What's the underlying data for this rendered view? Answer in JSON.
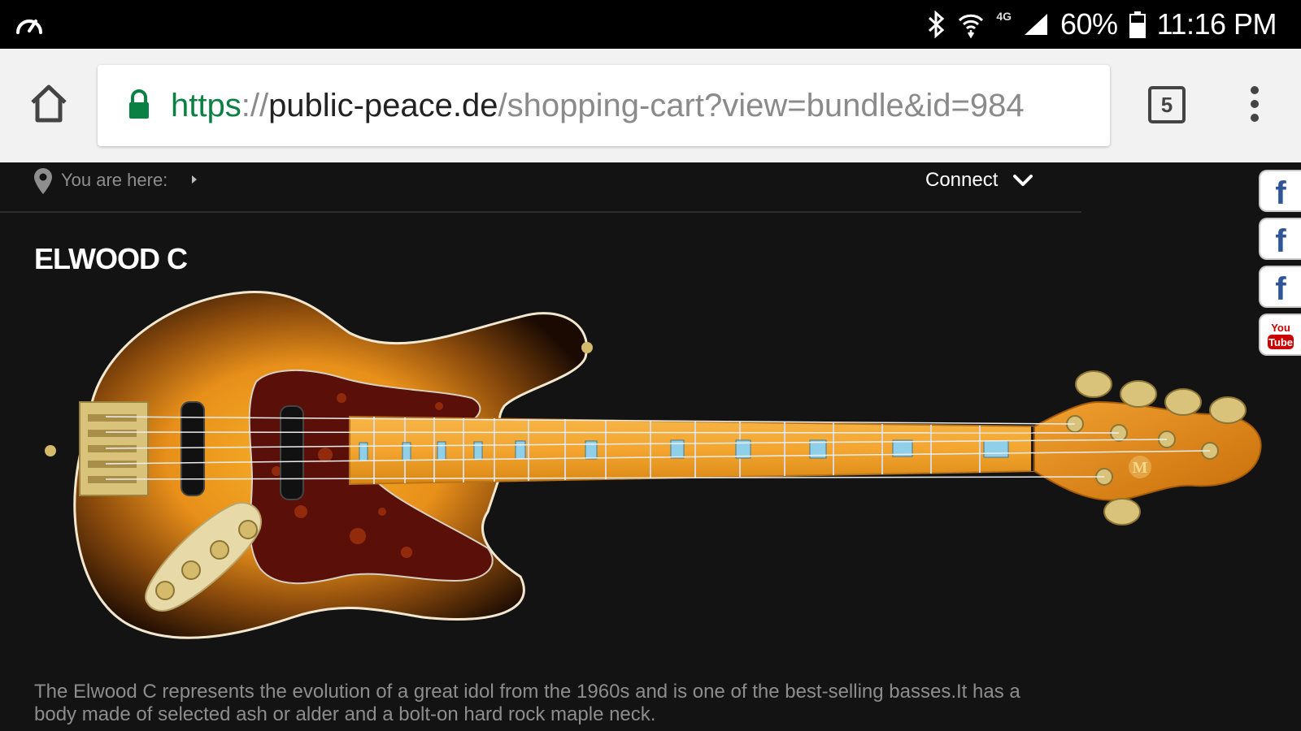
{
  "status_bar": {
    "battery": "60%",
    "time": "11:16 PM",
    "network": "4G",
    "icons": [
      "speedometer-icon",
      "bluetooth-icon",
      "wifi-icon",
      "signal-icon",
      "battery-icon"
    ]
  },
  "browser": {
    "url_scheme": "https",
    "url_sep": "://",
    "url_host": "public-peace.de",
    "url_path": "/shopping-cart?view=bundle&id=984",
    "tab_count": "5",
    "icons": [
      "home-icon",
      "lock-icon",
      "more-vert-icon"
    ],
    "accent": "#0b8043"
  },
  "nav": {
    "you_are_here": "You are here:",
    "connect": "Connect"
  },
  "social": {
    "items": [
      {
        "name": "facebook",
        "label": "f"
      },
      {
        "name": "facebook",
        "label": "f"
      },
      {
        "name": "facebook",
        "label": "f"
      },
      {
        "name": "youtube",
        "label_top": "You",
        "label_bottom": "Tube"
      }
    ]
  },
  "product": {
    "title": "ELWOOD C",
    "description": "The Elwood C represents the evolution of a great idol from the 1960s and is one of the best-selling basses.It has a body made of selected ash or alder and a bolt-on hard rock maple neck."
  },
  "colors": {
    "page_bg": "#131313",
    "sunburst_center": "#f0a020",
    "pickguard": "#5a0f08",
    "neck": "#f3a52f",
    "hardware": "#d9c27a"
  }
}
